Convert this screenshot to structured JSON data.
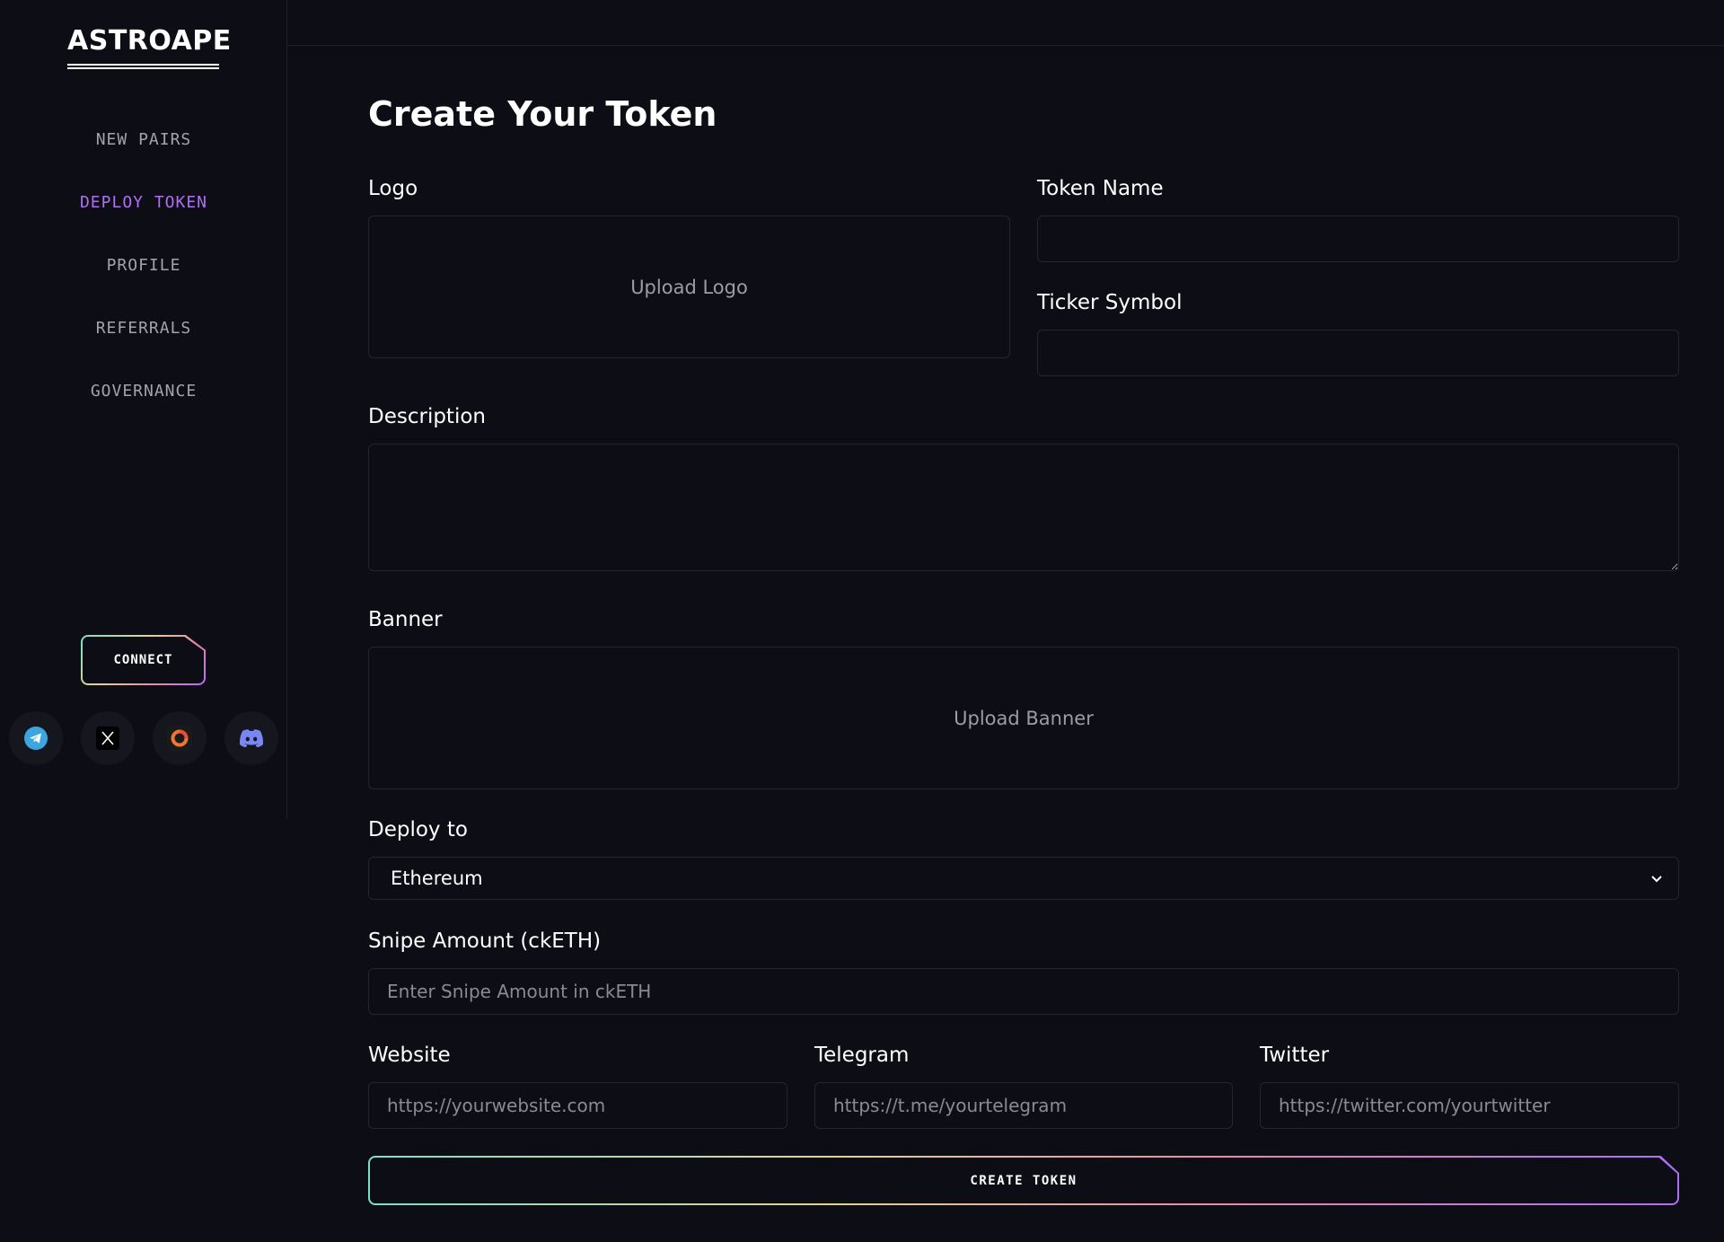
{
  "brand": {
    "name": "ASTROAPE"
  },
  "nav": {
    "items": [
      {
        "label": "NEW PAIRS"
      },
      {
        "label": "DEPLOY TOKEN",
        "active": true
      },
      {
        "label": "PROFILE"
      },
      {
        "label": "REFERRALS"
      },
      {
        "label": "GOVERNANCE"
      }
    ]
  },
  "connect": {
    "label": "CONNECT"
  },
  "socials": [
    "telegram-icon",
    "x-icon",
    "ring-icon",
    "discord-icon"
  ],
  "form": {
    "title": "Create Your Token",
    "logo": {
      "label": "Logo",
      "upload": "Upload Logo"
    },
    "token_name": {
      "label": "Token Name",
      "value": "",
      "placeholder": ""
    },
    "ticker": {
      "label": "Ticker Symbol",
      "value": "",
      "placeholder": ""
    },
    "description": {
      "label": "Description",
      "value": ""
    },
    "banner": {
      "label": "Banner",
      "upload": "Upload Banner"
    },
    "deploy_to": {
      "label": "Deploy to",
      "selected": "Ethereum"
    },
    "snipe": {
      "label": "Snipe Amount (ckETH)",
      "placeholder": "Enter Snipe Amount in ckETH"
    },
    "website": {
      "label": "Website",
      "placeholder": "https://yourwebsite.com"
    },
    "telegram": {
      "label": "Telegram",
      "placeholder": "https://t.me/yourtelegram"
    },
    "twitter": {
      "label": "Twitter",
      "placeholder": "https://twitter.com/yourtwitter"
    },
    "submit": "CREATE TOKEN"
  },
  "colors": {
    "background": "#0d0d15",
    "accent": "#b06ef5",
    "border": "#24252e"
  }
}
